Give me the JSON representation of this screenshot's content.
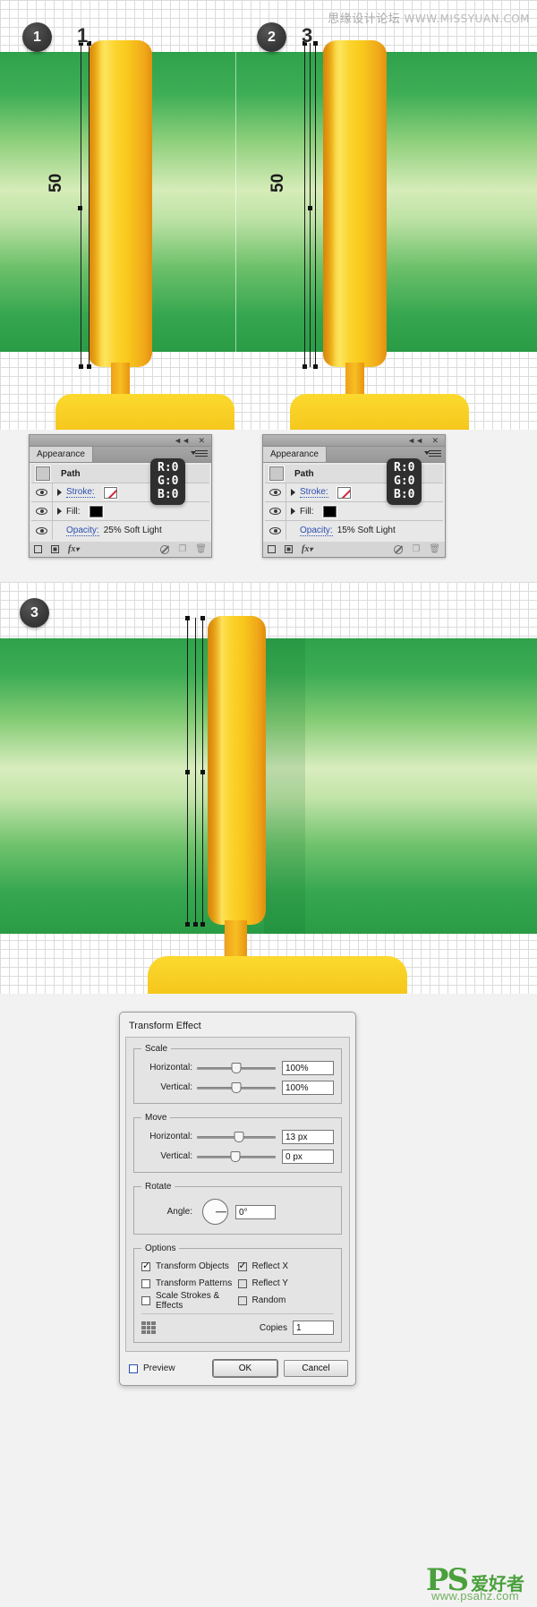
{
  "watermarks": {
    "top_cn": "思缘设计论坛",
    "top_url": "WWW.MISSYUAN.COM",
    "bottom_ps": "PS",
    "bottom_cn": "爱好者",
    "bottom_url": "www.psahz.com"
  },
  "steps": {
    "badge1": "1",
    "badge2": "2",
    "badge3": "3",
    "callout_left": "1",
    "callout_right": "3",
    "stroke_weight_left": "50",
    "stroke_weight_right": "50"
  },
  "appearance_panel_left": {
    "tab_label": "Appearance",
    "collapse_icon": "collapse-icon",
    "close_icon": "close-icon",
    "menu_icon": "panel-menu-icon",
    "target_label": "Path",
    "stroke_label": "Stroke:",
    "stroke_swatch": "none-swatch",
    "fill_label": "Fill:",
    "fill_swatch": "black-swatch",
    "opacity_label": "Opacity:",
    "opacity_value": "25% Soft Light",
    "footer": {
      "new_stroke_icon": "add-new-stroke-icon",
      "new_fill_icon": "add-new-fill-icon",
      "fx_icon": "fx-icon",
      "clear_icon": "clear-appearance-icon",
      "duplicate_icon": "duplicate-item-icon",
      "delete_icon": "delete-item-icon"
    },
    "rgb_tooltip": {
      "r": "R:0",
      "g": "G:0",
      "b": "B:0"
    }
  },
  "appearance_panel_right": {
    "tab_label": "Appearance",
    "collapse_icon": "collapse-icon",
    "close_icon": "close-icon",
    "menu_icon": "panel-menu-icon",
    "target_label": "Path",
    "stroke_label": "Stroke:",
    "stroke_swatch": "none-swatch",
    "fill_label": "Fill:",
    "fill_swatch": "black-swatch",
    "opacity_label": "Opacity:",
    "opacity_value": "15% Soft Light",
    "footer": {
      "new_stroke_icon": "add-new-stroke-icon",
      "new_fill_icon": "add-new-fill-icon",
      "fx_icon": "fx-icon",
      "clear_icon": "clear-appearance-icon",
      "duplicate_icon": "duplicate-item-icon",
      "delete_icon": "delete-item-icon"
    },
    "rgb_tooltip": {
      "r": "R:0",
      "g": "G:0",
      "b": "B:0"
    }
  },
  "transform_dialog": {
    "title": "Transform Effect",
    "scale": {
      "legend": "Scale",
      "horizontal_label": "Horizontal:",
      "horizontal_value": "100%",
      "vertical_label": "Vertical:",
      "vertical_value": "100%"
    },
    "move": {
      "legend": "Move",
      "horizontal_label": "Horizontal:",
      "horizontal_value": "13 px",
      "vertical_label": "Vertical:",
      "vertical_value": "0 px"
    },
    "rotate": {
      "legend": "Rotate",
      "angle_label": "Angle:",
      "angle_value": "0°",
      "dial_icon": "angle-dial-icon"
    },
    "options": {
      "legend": "Options",
      "items": [
        {
          "label": "Transform Objects",
          "checked": true
        },
        {
          "label": "Transform Patterns",
          "checked": false
        },
        {
          "label": "Scale Strokes & Effects",
          "checked": false
        },
        {
          "label": "Reflect X",
          "checked": true
        },
        {
          "label": "Reflect Y",
          "checked": false
        },
        {
          "label": "Random",
          "checked": false
        }
      ],
      "copies_label": "Copies",
      "copies_value": "1",
      "anchor_icon": "reference-point-grid-icon"
    },
    "preview_label": "Preview",
    "preview_checked": false,
    "ok_label": "OK",
    "cancel_label": "Cancel"
  },
  "colors": {
    "green_dark": "#2ea34a",
    "green_light": "#c7e8a8",
    "gold": "#f8c81c",
    "gold_dark": "#e8940f",
    "panel_bg": "#e8e8e8",
    "link_blue": "#2b4fb0",
    "badge_dark": "#333333",
    "watermark_green": "#4aa03c"
  }
}
